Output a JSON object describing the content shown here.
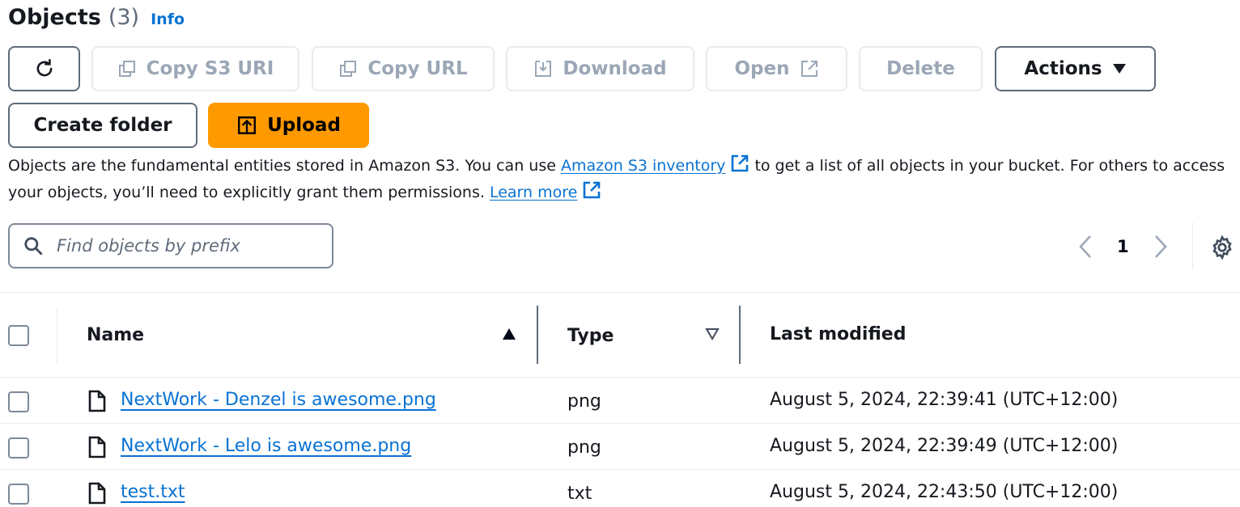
{
  "header": {
    "title": "Objects",
    "count": "(3)",
    "info": "Info"
  },
  "toolbar": {
    "refresh_icon": "refresh-icon",
    "copy_s3_uri": "Copy S3 URI",
    "copy_url": "Copy URL",
    "download": "Download",
    "open": "Open",
    "delete": "Delete",
    "actions": "Actions",
    "create_folder": "Create folder",
    "upload": "Upload"
  },
  "description": {
    "part1": "Objects are the fundamental entities stored in Amazon S3. You can use ",
    "inventory_link": "Amazon S3 inventory",
    "part2": " to get a list of all objects in your bucket. For others to access",
    "part3": "your objects, you’ll need to explicitly grant them permissions. ",
    "learn_more": "Learn more"
  },
  "search": {
    "placeholder": "Find objects by prefix"
  },
  "pagination": {
    "current_page": "1"
  },
  "table": {
    "columns": {
      "name": "Name",
      "type": "Type",
      "last_modified": "Last modified"
    },
    "rows": [
      {
        "name": "NextWork - Denzel is awesome.png",
        "type": "png",
        "last_modified": "August 5, 2024, 22:39:41 (UTC+12:00)"
      },
      {
        "name": "NextWork - Lelo is awesome.png",
        "type": "png",
        "last_modified": "August 5, 2024, 22:39:49 (UTC+12:00)"
      },
      {
        "name": "test.txt",
        "type": "txt",
        "last_modified": "August 5, 2024, 22:43:50 (UTC+12:00)"
      }
    ]
  },
  "colors": {
    "link": "#0972d3",
    "primary": "#ff9900",
    "disabled_text": "#9ba7b6",
    "border": "#5f6b7a"
  }
}
